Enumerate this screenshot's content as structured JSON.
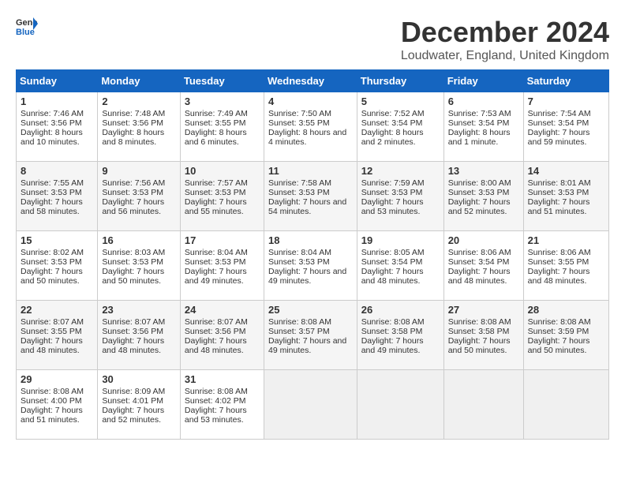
{
  "header": {
    "logo_general": "General",
    "logo_blue": "Blue",
    "title": "December 2024",
    "subtitle": "Loudwater, England, United Kingdom"
  },
  "columns": [
    "Sunday",
    "Monday",
    "Tuesday",
    "Wednesday",
    "Thursday",
    "Friday",
    "Saturday"
  ],
  "weeks": [
    [
      {
        "day": "1",
        "sunrise": "Sunrise: 7:46 AM",
        "sunset": "Sunset: 3:56 PM",
        "daylight": "Daylight: 8 hours and 10 minutes."
      },
      {
        "day": "2",
        "sunrise": "Sunrise: 7:48 AM",
        "sunset": "Sunset: 3:56 PM",
        "daylight": "Daylight: 8 hours and 8 minutes."
      },
      {
        "day": "3",
        "sunrise": "Sunrise: 7:49 AM",
        "sunset": "Sunset: 3:55 PM",
        "daylight": "Daylight: 8 hours and 6 minutes."
      },
      {
        "day": "4",
        "sunrise": "Sunrise: 7:50 AM",
        "sunset": "Sunset: 3:55 PM",
        "daylight": "Daylight: 8 hours and 4 minutes."
      },
      {
        "day": "5",
        "sunrise": "Sunrise: 7:52 AM",
        "sunset": "Sunset: 3:54 PM",
        "daylight": "Daylight: 8 hours and 2 minutes."
      },
      {
        "day": "6",
        "sunrise": "Sunrise: 7:53 AM",
        "sunset": "Sunset: 3:54 PM",
        "daylight": "Daylight: 8 hours and 1 minute."
      },
      {
        "day": "7",
        "sunrise": "Sunrise: 7:54 AM",
        "sunset": "Sunset: 3:54 PM",
        "daylight": "Daylight: 7 hours and 59 minutes."
      }
    ],
    [
      {
        "day": "8",
        "sunrise": "Sunrise: 7:55 AM",
        "sunset": "Sunset: 3:53 PM",
        "daylight": "Daylight: 7 hours and 58 minutes."
      },
      {
        "day": "9",
        "sunrise": "Sunrise: 7:56 AM",
        "sunset": "Sunset: 3:53 PM",
        "daylight": "Daylight: 7 hours and 56 minutes."
      },
      {
        "day": "10",
        "sunrise": "Sunrise: 7:57 AM",
        "sunset": "Sunset: 3:53 PM",
        "daylight": "Daylight: 7 hours and 55 minutes."
      },
      {
        "day": "11",
        "sunrise": "Sunrise: 7:58 AM",
        "sunset": "Sunset: 3:53 PM",
        "daylight": "Daylight: 7 hours and 54 minutes."
      },
      {
        "day": "12",
        "sunrise": "Sunrise: 7:59 AM",
        "sunset": "Sunset: 3:53 PM",
        "daylight": "Daylight: 7 hours and 53 minutes."
      },
      {
        "day": "13",
        "sunrise": "Sunrise: 8:00 AM",
        "sunset": "Sunset: 3:53 PM",
        "daylight": "Daylight: 7 hours and 52 minutes."
      },
      {
        "day": "14",
        "sunrise": "Sunrise: 8:01 AM",
        "sunset": "Sunset: 3:53 PM",
        "daylight": "Daylight: 7 hours and 51 minutes."
      }
    ],
    [
      {
        "day": "15",
        "sunrise": "Sunrise: 8:02 AM",
        "sunset": "Sunset: 3:53 PM",
        "daylight": "Daylight: 7 hours and 50 minutes."
      },
      {
        "day": "16",
        "sunrise": "Sunrise: 8:03 AM",
        "sunset": "Sunset: 3:53 PM",
        "daylight": "Daylight: 7 hours and 50 minutes."
      },
      {
        "day": "17",
        "sunrise": "Sunrise: 8:04 AM",
        "sunset": "Sunset: 3:53 PM",
        "daylight": "Daylight: 7 hours and 49 minutes."
      },
      {
        "day": "18",
        "sunrise": "Sunrise: 8:04 AM",
        "sunset": "Sunset: 3:53 PM",
        "daylight": "Daylight: 7 hours and 49 minutes."
      },
      {
        "day": "19",
        "sunrise": "Sunrise: 8:05 AM",
        "sunset": "Sunset: 3:54 PM",
        "daylight": "Daylight: 7 hours and 48 minutes."
      },
      {
        "day": "20",
        "sunrise": "Sunrise: 8:06 AM",
        "sunset": "Sunset: 3:54 PM",
        "daylight": "Daylight: 7 hours and 48 minutes."
      },
      {
        "day": "21",
        "sunrise": "Sunrise: 8:06 AM",
        "sunset": "Sunset: 3:55 PM",
        "daylight": "Daylight: 7 hours and 48 minutes."
      }
    ],
    [
      {
        "day": "22",
        "sunrise": "Sunrise: 8:07 AM",
        "sunset": "Sunset: 3:55 PM",
        "daylight": "Daylight: 7 hours and 48 minutes."
      },
      {
        "day": "23",
        "sunrise": "Sunrise: 8:07 AM",
        "sunset": "Sunset: 3:56 PM",
        "daylight": "Daylight: 7 hours and 48 minutes."
      },
      {
        "day": "24",
        "sunrise": "Sunrise: 8:07 AM",
        "sunset": "Sunset: 3:56 PM",
        "daylight": "Daylight: 7 hours and 48 minutes."
      },
      {
        "day": "25",
        "sunrise": "Sunrise: 8:08 AM",
        "sunset": "Sunset: 3:57 PM",
        "daylight": "Daylight: 7 hours and 49 minutes."
      },
      {
        "day": "26",
        "sunrise": "Sunrise: 8:08 AM",
        "sunset": "Sunset: 3:58 PM",
        "daylight": "Daylight: 7 hours and 49 minutes."
      },
      {
        "day": "27",
        "sunrise": "Sunrise: 8:08 AM",
        "sunset": "Sunset: 3:58 PM",
        "daylight": "Daylight: 7 hours and 50 minutes."
      },
      {
        "day": "28",
        "sunrise": "Sunrise: 8:08 AM",
        "sunset": "Sunset: 3:59 PM",
        "daylight": "Daylight: 7 hours and 50 minutes."
      }
    ],
    [
      {
        "day": "29",
        "sunrise": "Sunrise: 8:08 AM",
        "sunset": "Sunset: 4:00 PM",
        "daylight": "Daylight: 7 hours and 51 minutes."
      },
      {
        "day": "30",
        "sunrise": "Sunrise: 8:09 AM",
        "sunset": "Sunset: 4:01 PM",
        "daylight": "Daylight: 7 hours and 52 minutes."
      },
      {
        "day": "31",
        "sunrise": "Sunrise: 8:08 AM",
        "sunset": "Sunset: 4:02 PM",
        "daylight": "Daylight: 7 hours and 53 minutes."
      },
      null,
      null,
      null,
      null
    ]
  ]
}
